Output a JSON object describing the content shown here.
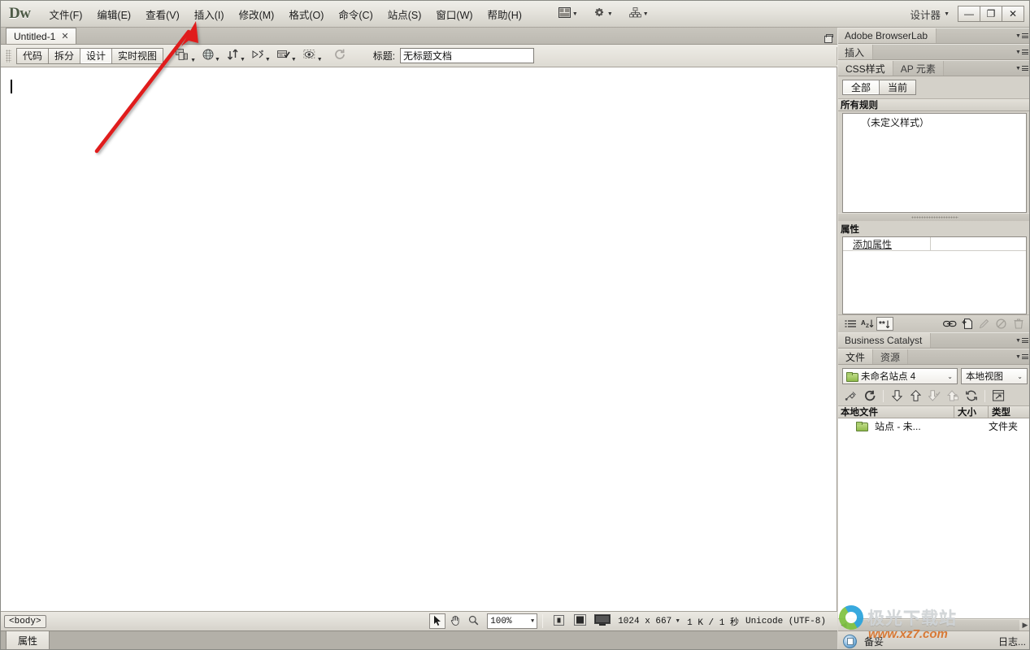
{
  "app": {
    "logo": "Dw",
    "workspace": "设计器"
  },
  "menubar": {
    "items": [
      {
        "label": "文件(F)"
      },
      {
        "label": "编辑(E)"
      },
      {
        "label": "查看(V)"
      },
      {
        "label": "插入(I)"
      },
      {
        "label": "修改(M)"
      },
      {
        "label": "格式(O)"
      },
      {
        "label": "命令(C)"
      },
      {
        "label": "站点(S)"
      },
      {
        "label": "窗口(W)"
      },
      {
        "label": "帮助(H)"
      }
    ],
    "right_icons": [
      {
        "name": "layout-switcher-icon"
      },
      {
        "name": "gear-icon"
      },
      {
        "name": "site-network-icon"
      }
    ]
  },
  "window_controls": {
    "minimize": "—",
    "maximize": "❐",
    "close": "✕"
  },
  "document_tabs": [
    {
      "label": "Untitled-1",
      "close": "✕",
      "active": true
    }
  ],
  "doc_toolbar": {
    "view_buttons": [
      {
        "label": "代码",
        "active": false
      },
      {
        "label": "拆分",
        "active": false
      },
      {
        "label": "设计",
        "active": true
      },
      {
        "label": "实时视图",
        "active": false
      }
    ],
    "icons": [
      {
        "name": "multiscreen-preview-icon"
      },
      {
        "name": "preview-in-browser-icon"
      },
      {
        "name": "file-management-icon"
      },
      {
        "name": "code-navigator-icon"
      },
      {
        "name": "validate-markup-icon"
      },
      {
        "name": "live-view-inspect-icon"
      },
      {
        "name": "refresh-icon"
      }
    ],
    "title_label": "标题:",
    "title_value": "无标题文档"
  },
  "status_bar": {
    "tag_selector": "<body>",
    "tools": [
      {
        "name": "select-tool-icon",
        "active": true
      },
      {
        "name": "hand-tool-icon",
        "active": false
      },
      {
        "name": "zoom-tool-icon",
        "active": false
      }
    ],
    "zoom_level": "100%",
    "window_size_buttons": [
      {
        "name": "mobile-size-icon"
      },
      {
        "name": "tablet-size-icon"
      },
      {
        "name": "desktop-size-icon"
      }
    ],
    "dimensions": "1024 x 667",
    "download_size": "1 K / 1 秒",
    "encoding": "Unicode (UTF-8)"
  },
  "properties_bar": {
    "tab_label": "属性"
  },
  "dock": {
    "browserlab": {
      "title": "Adobe BrowserLab"
    },
    "insert": {
      "title": "插入"
    },
    "css_panel": {
      "tabs": [
        {
          "label": "CSS样式",
          "active": true
        },
        {
          "label": "AP 元素",
          "active": false
        }
      ],
      "segments": [
        {
          "label": "全部",
          "active": true
        },
        {
          "label": "当前",
          "active": false
        }
      ],
      "rules_header": "所有规则",
      "rules": [
        "（未定义样式）"
      ],
      "properties_header": "属性",
      "add_property_label": "添加属性",
      "footer_icons": [
        {
          "name": "category-view-icon"
        },
        {
          "name": "alphabetical-view-icon"
        },
        {
          "name": "set-properties-view-icon"
        },
        {
          "name": "attach-stylesheet-icon"
        },
        {
          "name": "new-css-rule-icon"
        },
        {
          "name": "edit-rule-icon"
        },
        {
          "name": "disable-property-icon"
        },
        {
          "name": "delete-property-icon"
        }
      ]
    },
    "business_catalyst": {
      "title": "Business Catalyst"
    },
    "files_panel": {
      "tabs": [
        {
          "label": "文件",
          "active": true
        },
        {
          "label": "资源",
          "active": false
        }
      ],
      "site_select": "未命名站点 4",
      "view_select": "本地视图",
      "toolbar_icons": [
        {
          "name": "connect-to-remote-icon"
        },
        {
          "name": "refresh-icon"
        },
        {
          "name": "get-files-icon"
        },
        {
          "name": "put-files-icon"
        },
        {
          "name": "check-out-icon"
        },
        {
          "name": "check-in-icon"
        },
        {
          "name": "synchronize-icon"
        },
        {
          "name": "expand-panel-icon"
        }
      ],
      "columns": [
        "本地文件",
        "大小",
        "类型"
      ],
      "rows": [
        {
          "name": "站点 - 未...",
          "size": "",
          "type": "文件夹"
        }
      ]
    },
    "footer": {
      "status": "备妥",
      "log_label": "日志..."
    }
  },
  "watermark": {
    "title": "极光下载站",
    "url_main": "www.xz7",
    "url_suffix": ".com"
  },
  "annotation": {
    "arrow_color": "#e01b1b",
    "points_to": "插入(I)"
  }
}
